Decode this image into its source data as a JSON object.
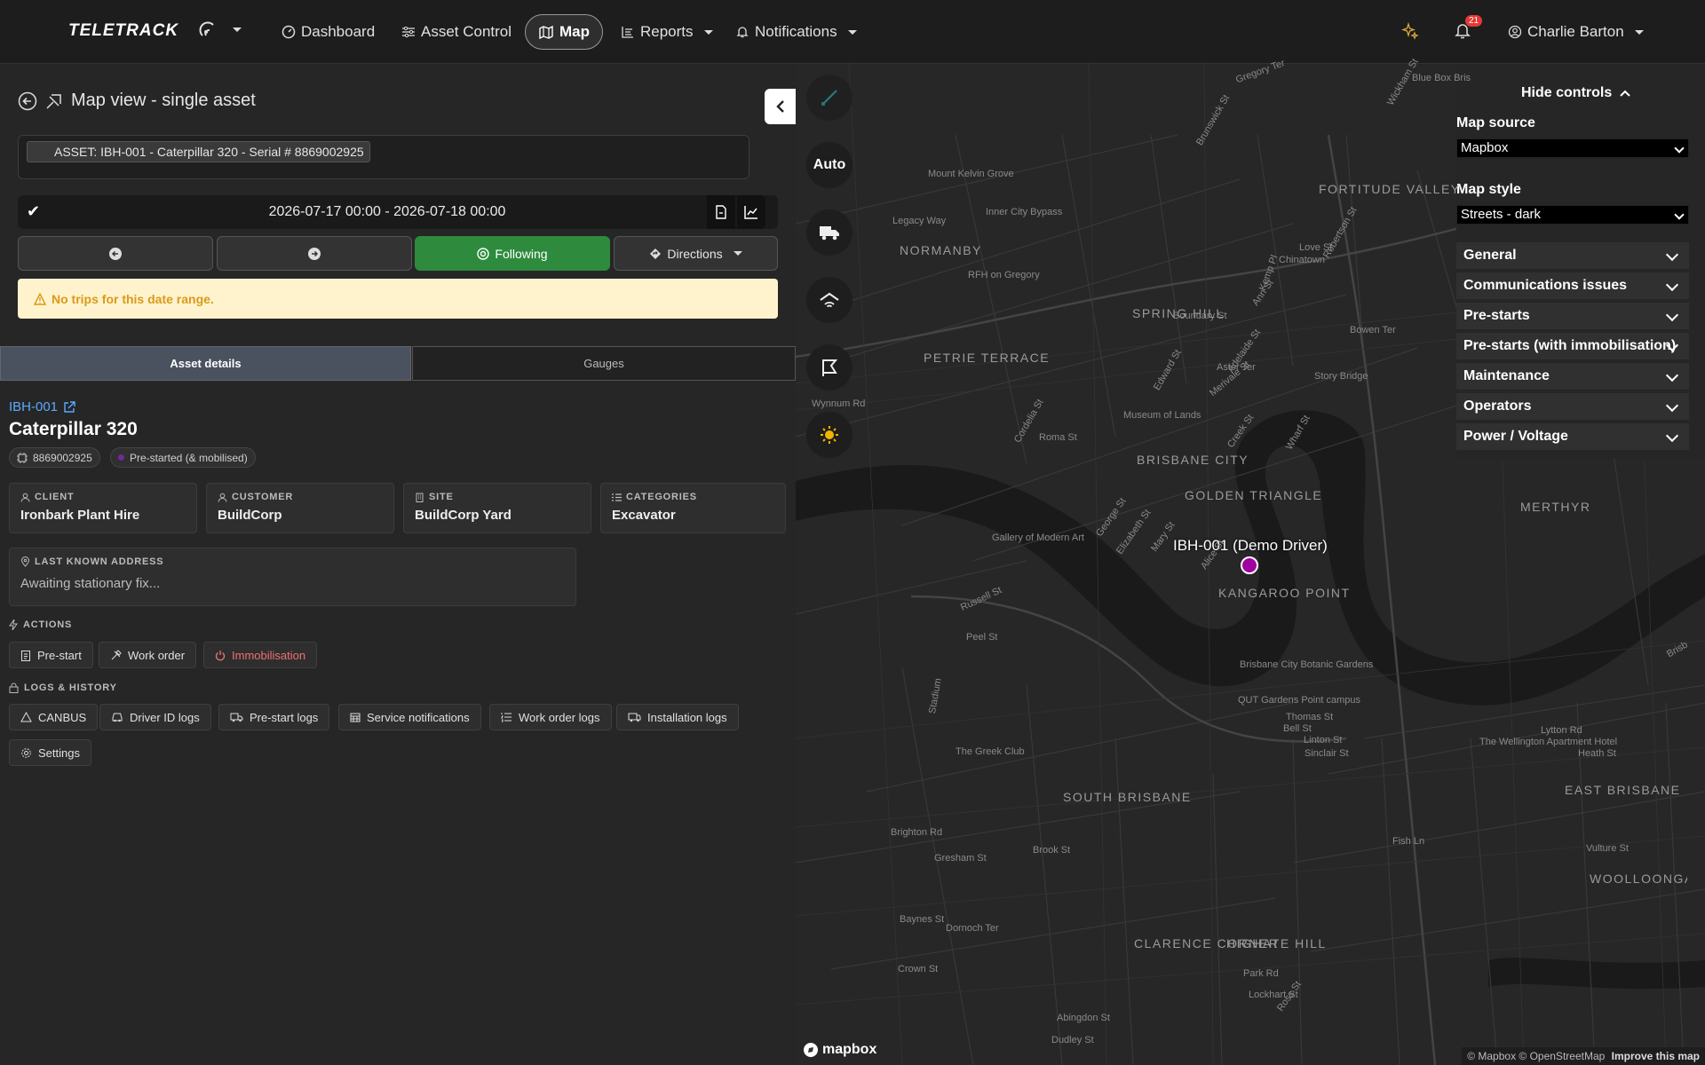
{
  "nav": {
    "logo": "TELETRACK",
    "items": [
      {
        "label": "Dashboard"
      },
      {
        "label": "Asset Control"
      },
      {
        "label": "Map"
      },
      {
        "label": "Reports"
      },
      {
        "label": "Notifications"
      }
    ],
    "notification_count": "21",
    "user": "Charlie Barton"
  },
  "page": {
    "title": "Map view - single asset",
    "asset_chip": "ASSET: IBH-001 - Caterpillar 320 - Serial # 8869002925",
    "date_range": "2026-07-17 00:00 - 2026-07-18 00:00",
    "following_label": "Following",
    "directions_label": "Directions",
    "alert": "No trips for this date range."
  },
  "tabs": {
    "details": "Asset details",
    "gauges": "Gauges"
  },
  "asset": {
    "id": "IBH-001",
    "name": "Caterpillar 320",
    "serial": "8869002925",
    "status": "Pre-started (& mobilised)",
    "cards": {
      "client_label": "CLIENT",
      "client": "Ironbark Plant Hire",
      "customer_label": "CUSTOMER",
      "customer": "BuildCorp",
      "site_label": "SITE",
      "site": "BuildCorp Yard",
      "categories_label": "CATEGORIES",
      "categories": "Excavator"
    },
    "address_label": "LAST KNOWN ADDRESS",
    "address": "Awaiting stationary fix..."
  },
  "actions": {
    "title": "ACTIONS",
    "items": [
      "Pre-start",
      "Work order",
      "Immobilisation"
    ]
  },
  "logs": {
    "title": "LOGS & HISTORY",
    "items": [
      "CANBUS",
      "Driver ID logs",
      "Pre-start logs",
      "Service notifications",
      "Work order logs",
      "Installation logs",
      "Settings"
    ]
  },
  "map": {
    "auto_label": "Auto",
    "marker_label": "IBH-001 (Demo Driver)",
    "attribution": "© Mapbox © OpenStreetMap",
    "improve": "Improve this map",
    "brand": "mapbox",
    "controls": {
      "hide": "Hide controls",
      "source_label": "Map source",
      "source_value": "Mapbox",
      "style_label": "Map style",
      "style_value": "Streets - dark",
      "sections": [
        "General",
        "Communications issues",
        "Pre-starts",
        "Pre-starts (with immobilisation)",
        "Maintenance",
        "Operators",
        "Power / Voltage"
      ]
    },
    "labels": [
      "Gregory Ter",
      "Blue Box Bris",
      "Brunswick St",
      "FORTITUDE VALLEY",
      "Wickham St",
      "Mount Kelvin Grove",
      "Legacy Way",
      "Inner City Bypass",
      "Chinatown",
      "NORMANBY",
      "RFH on Gregory",
      "SPRING HILL",
      "Boundary St",
      "Ann St",
      "Story Bridge",
      "PETRIE TERRACE",
      "Astor Ter",
      "Adelaide St",
      "Museum of Lands",
      "Roma St",
      "BRISBANE CITY",
      "GOLDEN TRIANGLE",
      "Gallery of Modern Art",
      "George St",
      "Elizabeth St",
      "Mary St",
      "Alice St",
      "KANGAROO POINT",
      "MERTHYR",
      "Brisbane City Botanic Gardens",
      "QUT Gardens Point campus",
      "The Greek Club",
      "SOUTH BRISBANE",
      "Thomas St",
      "Lytton Rd",
      "The Wellington Apartment Hotel",
      "Heath St",
      "EAST BRISBANE",
      "Brighton Rd",
      "Brook St",
      "Vulture St",
      "WOOLLOONGABBA",
      "Gresham St",
      "Baynes St",
      "Dornoch Ter",
      "HIGHATE HILL",
      "CLARENCE CORNER",
      "Crown St",
      "Dudley St",
      "Park Rd",
      "Lockhart St",
      "Ross St",
      "Abingdon St",
      "Brisbane River",
      "Wynnum Rd",
      "Stadium",
      "Russell St",
      "Peel St",
      "Fish Ln",
      "Linton St",
      "Sinclair St",
      "Bell St",
      "Cordelia St",
      "Merivale St",
      "Edward St",
      "Creek St",
      "Wharf St",
      "Kemp Pl",
      "Robertson St",
      "Bowen Ter",
      "Love St"
    ]
  }
}
